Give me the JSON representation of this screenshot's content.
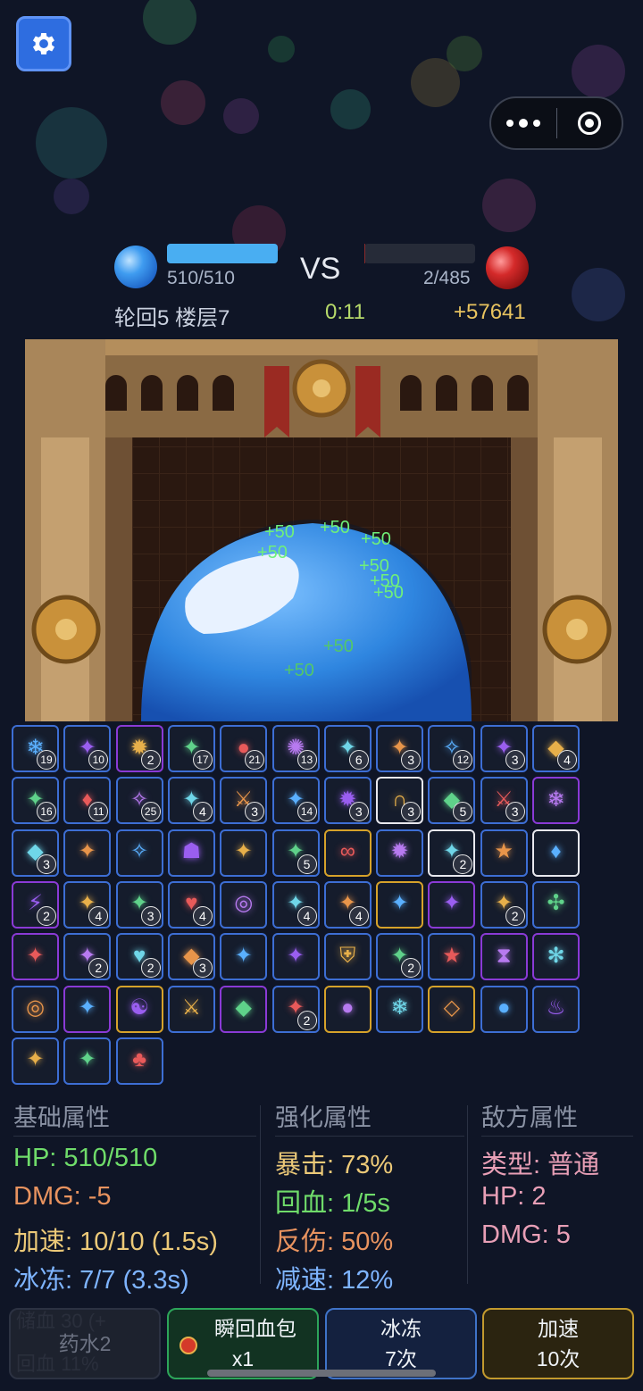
{
  "colors": {
    "background": "#0f1526",
    "hp_bar": "#49aef2",
    "green": "#6fdc6a",
    "orange": "#e8935f",
    "yellow": "#ecc978",
    "blue": "#7eb4ff",
    "pink": "#e89fb6",
    "gray": "#8b93a5"
  },
  "top": {
    "settings_icon": "gear-icon",
    "menu_icon": "more-dots-icon",
    "close_icon": "target-circle-icon"
  },
  "hud": {
    "player_hp": "510/510",
    "player_hp_fraction": 1.0,
    "vs": "VS",
    "enemy_hp": "2/485",
    "enemy_hp_fraction": 0.004,
    "level": "轮回5 楼层7",
    "timer": "0:11",
    "gold": "+57641"
  },
  "floating_heals": [
    "+50",
    "+50",
    "+50",
    "+50",
    "+50",
    "+50",
    "+50",
    "+50",
    "+50"
  ],
  "items": [
    {
      "icon": "frost-dragon-icon",
      "count": "19",
      "rarity": "blue"
    },
    {
      "icon": "dark-scroll-icon",
      "count": "10",
      "rarity": "blue"
    },
    {
      "icon": "fire-wheel-icon",
      "count": "2",
      "rarity": "purple"
    },
    {
      "icon": "golden-serpent-icon",
      "count": "17",
      "rarity": "blue"
    },
    {
      "icon": "bronze-orb-icon",
      "count": "21",
      "rarity": "blue"
    },
    {
      "icon": "void-vortex-icon",
      "count": "13",
      "rarity": "blue"
    },
    {
      "icon": "emerald-beast-icon",
      "count": "6",
      "rarity": "blue"
    },
    {
      "icon": "golden-idol-icon",
      "count": "3",
      "rarity": "blue"
    },
    {
      "icon": "jade-claw-icon",
      "count": "12",
      "rarity": "blue"
    },
    {
      "icon": "storm-spirit-icon",
      "count": "3",
      "rarity": "blue"
    },
    {
      "icon": "tri-gem-icon",
      "count": "4",
      "rarity": "blue"
    },
    {
      "icon": "ice-dragon-icon",
      "count": "16",
      "rarity": "blue"
    },
    {
      "icon": "blood-blade-icon",
      "count": "11",
      "rarity": "blue"
    },
    {
      "icon": "jade-wing-icon",
      "count": "25",
      "rarity": "blue"
    },
    {
      "icon": "golden-armor-icon",
      "count": "4",
      "rarity": "blue"
    },
    {
      "icon": "flame-sword-icon",
      "count": "3",
      "rarity": "blue"
    },
    {
      "icon": "crimson-claws-icon",
      "count": "14",
      "rarity": "blue"
    },
    {
      "icon": "fire-blade-icon",
      "count": "3",
      "rarity": "blue"
    },
    {
      "icon": "horseshoe-magnet-icon",
      "count": "3",
      "rarity": "white"
    },
    {
      "icon": "amethyst-crystal-icon",
      "count": "5",
      "rarity": "blue"
    },
    {
      "icon": "holy-sword-icon",
      "count": "3",
      "rarity": "blue"
    },
    {
      "icon": "frost-burst-icon",
      "count": "",
      "rarity": "purple"
    },
    {
      "icon": "shadow-crystal-icon",
      "count": "3",
      "rarity": "blue"
    },
    {
      "icon": "blue-tornado-icon",
      "count": "",
      "rarity": "blue"
    },
    {
      "icon": "jade-lizard-icon",
      "count": "",
      "rarity": "blue"
    },
    {
      "icon": "demon-mask-icon",
      "count": "",
      "rarity": "blue"
    },
    {
      "icon": "red-sigil-icon",
      "count": "",
      "rarity": "blue"
    },
    {
      "icon": "golden-blade-icon",
      "count": "5",
      "rarity": "blue"
    },
    {
      "icon": "silver-chain-icon",
      "count": "",
      "rarity": "gold"
    },
    {
      "icon": "fire-vortex-icon",
      "count": "",
      "rarity": "blue"
    },
    {
      "icon": "golden-scythe-icon",
      "count": "2",
      "rarity": "white"
    },
    {
      "icon": "ice-star-icon",
      "count": "",
      "rarity": "blue"
    },
    {
      "icon": "blood-moon-icon",
      "count": "",
      "rarity": "white"
    },
    {
      "icon": "lightning-bolt-icon",
      "count": "2",
      "rarity": "purple"
    },
    {
      "icon": "thunder-strike-icon",
      "count": "4",
      "rarity": "blue"
    },
    {
      "icon": "golden-crown-icon",
      "count": "3",
      "rarity": "blue"
    },
    {
      "icon": "green-heart-icon",
      "count": "4",
      "rarity": "blue"
    },
    {
      "icon": "arcane-ring-icon",
      "count": "",
      "rarity": "blue"
    },
    {
      "icon": "golden-mace-icon",
      "count": "4",
      "rarity": "blue"
    },
    {
      "icon": "golden-lightning-icon",
      "count": "4",
      "rarity": "blue"
    },
    {
      "icon": "ice-shard-icon",
      "count": "",
      "rarity": "gold"
    },
    {
      "icon": "pink-nebula-icon",
      "count": "",
      "rarity": "purple"
    },
    {
      "icon": "golden-sun-icon",
      "count": "2",
      "rarity": "blue"
    },
    {
      "icon": "teal-compass-icon",
      "count": "",
      "rarity": "blue"
    },
    {
      "icon": "azure-flame-icon",
      "count": "",
      "rarity": "purple"
    },
    {
      "icon": "blue-staff-icon",
      "count": "2",
      "rarity": "blue"
    },
    {
      "icon": "crimson-heart-icon",
      "count": "2",
      "rarity": "blue"
    },
    {
      "icon": "ice-crystal-icon",
      "count": "3",
      "rarity": "blue"
    },
    {
      "icon": "golden-tome-icon",
      "count": "",
      "rarity": "blue"
    },
    {
      "icon": "violet-warrior-icon",
      "count": "",
      "rarity": "blue"
    },
    {
      "icon": "green-shield-icon",
      "count": "",
      "rarity": "blue"
    },
    {
      "icon": "blue-brain-icon",
      "count": "2",
      "rarity": "blue"
    },
    {
      "icon": "radiant-star-icon",
      "count": "",
      "rarity": "blue"
    },
    {
      "icon": "hourglass-icon",
      "count": "",
      "rarity": "purple"
    },
    {
      "icon": "red-spider-icon",
      "count": "",
      "rarity": "purple"
    },
    {
      "icon": "blue-portal-icon",
      "count": "",
      "rarity": "blue"
    },
    {
      "icon": "bronze-medallion-icon",
      "count": "",
      "rarity": "purple"
    },
    {
      "icon": "yin-yang-icon",
      "count": "",
      "rarity": "gold"
    },
    {
      "icon": "feather-blade-icon",
      "count": "",
      "rarity": "blue"
    },
    {
      "icon": "purple-gem-icon",
      "count": "",
      "rarity": "purple"
    },
    {
      "icon": "golden-shield-icon",
      "count": "2",
      "rarity": "blue"
    },
    {
      "icon": "cosmic-orb-icon",
      "count": "",
      "rarity": "gold"
    },
    {
      "icon": "frost-lance-icon",
      "count": "",
      "rarity": "blue"
    },
    {
      "icon": "diamond-icon",
      "count": "",
      "rarity": "gold"
    },
    {
      "icon": "galaxy-orb-icon",
      "count": "",
      "rarity": "blue"
    },
    {
      "icon": "emerald-lantern-icon",
      "count": "",
      "rarity": "blue"
    },
    {
      "icon": "flame-dagger-icon",
      "count": "",
      "rarity": "blue"
    },
    {
      "icon": "green-rune-icon",
      "count": "",
      "rarity": "blue"
    },
    {
      "icon": "four-leaf-clover-icon",
      "count": "",
      "rarity": "blue"
    }
  ],
  "stats": {
    "base": {
      "title": "基础属性",
      "hp": "HP: 510/510",
      "dmg": "DMG: -5",
      "speed": "加速: 10/10 (1.5s)",
      "freeze": "冰冻: 7/7 (3.3s)"
    },
    "enhance": {
      "title": "强化属性",
      "crit": "暴击: 73%",
      "regen": "回血: 1/5s",
      "reflect": "反伤: 50%",
      "slow": "减速: 12%"
    },
    "enemy": {
      "title": "敌方属性",
      "type": "类型: 普通",
      "hp": "HP: 2",
      "dmg": "DMG: 5"
    }
  },
  "buttons": {
    "potion": {
      "label": "药水2",
      "ghost1": "储血 30 (+",
      "ghost2": "回血 11%"
    },
    "heal": {
      "line1": "瞬回血包",
      "line2": "x1"
    },
    "freeze": {
      "line1": "冰冻",
      "line2": "7次"
    },
    "speed": {
      "line1": "加速",
      "line2": "10次"
    }
  }
}
